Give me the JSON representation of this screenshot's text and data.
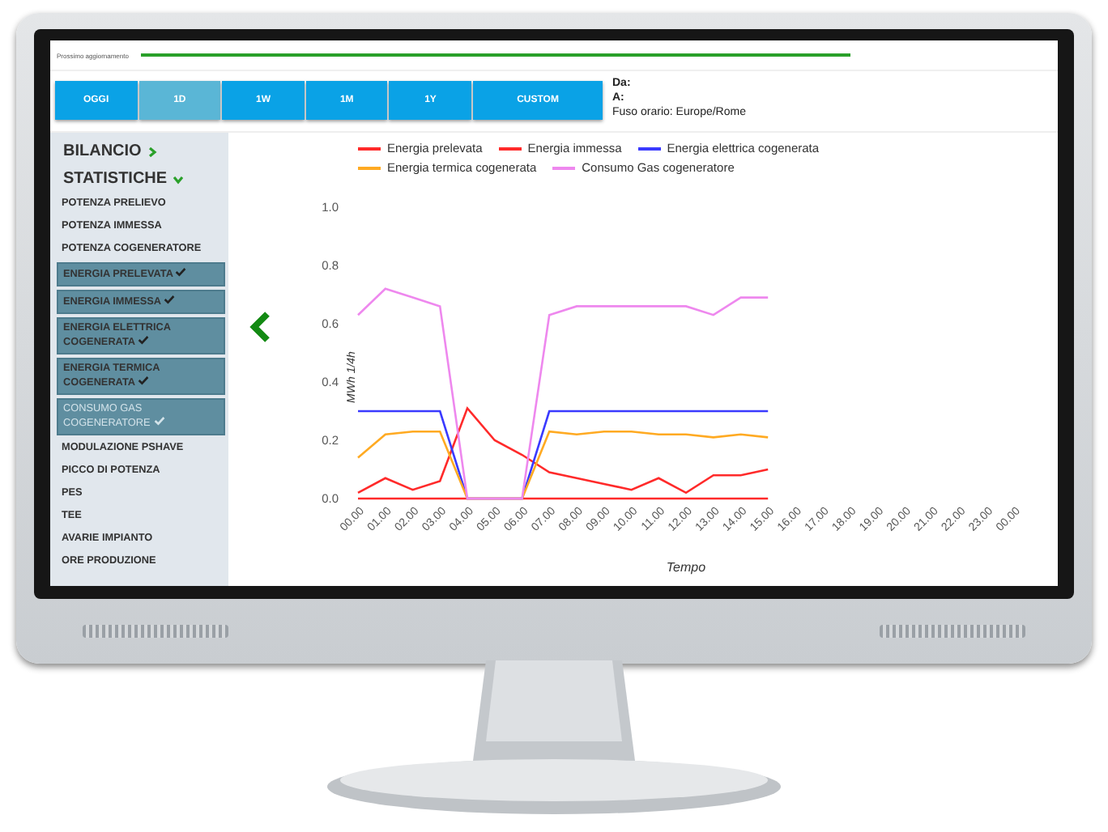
{
  "update_bar": {
    "label": "Prossimo aggiornamento",
    "level": 0.78
  },
  "tabs": [
    {
      "label": "OGGI",
      "selected": false
    },
    {
      "label": "1D",
      "selected": true
    },
    {
      "label": "1W",
      "selected": false
    },
    {
      "label": "1M",
      "selected": false
    },
    {
      "label": "1Y",
      "selected": false
    },
    {
      "label": "CUSTOM",
      "selected": false
    }
  ],
  "range_info": [
    "Da:",
    "A:",
    "Fuso orario: Europe/Rome"
  ],
  "sidebar": {
    "sections": [
      {
        "label": "BILANCIO",
        "expanded": false
      },
      {
        "label": "STATISTICHE",
        "expanded": true,
        "items": [
          {
            "label": "POTENZA PRELIEVO",
            "checked": false,
            "disabled": false
          },
          {
            "label": "POTENZA IMMESSA",
            "checked": false,
            "disabled": false
          },
          {
            "label": "POTENZA COGENERATORE",
            "checked": false,
            "disabled": false
          },
          {
            "label": "ENERGIA PRELEVATA",
            "checked": true,
            "disabled": false
          },
          {
            "label": "ENERGIA IMMESSA",
            "checked": true,
            "disabled": false
          },
          {
            "label": "ENERGIA ELETTRICA COGENERATA",
            "checked": true,
            "disabled": false
          },
          {
            "label": "ENERGIA TERMICA COGENERATA",
            "checked": true,
            "disabled": false
          },
          {
            "label": "CONSUMO GAS COGENERATORE",
            "checked": true,
            "disabled": true
          },
          {
            "label": "MODULAZIONE PSHAVE",
            "checked": false,
            "disabled": false
          },
          {
            "label": "PICCO DI POTENZA",
            "checked": false,
            "disabled": false
          },
          {
            "label": "PES",
            "checked": false,
            "disabled": false
          },
          {
            "label": "TEE",
            "checked": false,
            "disabled": false
          },
          {
            "label": "AVARIE IMPIANTO",
            "checked": false,
            "disabled": false
          },
          {
            "label": "ORE PRODUZIONE",
            "checked": false,
            "disabled": false
          }
        ]
      }
    ]
  },
  "chart": {
    "chart_data": {
      "type": "line",
      "xlabel": "Tempo",
      "ylabel": "MWh 1/4h",
      "categories": [
        "00.00",
        "01.00",
        "02.00",
        "03.00",
        "04.00",
        "05.00",
        "06.00",
        "07.00",
        "08.00",
        "09.00",
        "10.00",
        "11.00",
        "12.00",
        "13.00",
        "14.00",
        "15.00",
        "16.00",
        "17.00",
        "18.00",
        "19.00",
        "20.00",
        "21.00",
        "22.00",
        "23.00",
        "00.00"
      ],
      "ylim": [
        0,
        1
      ],
      "yticks": [
        {
          "value": 0,
          "label": "0.0"
        },
        {
          "value": 0.2,
          "label": "0.2"
        },
        {
          "value": 0.4,
          "label": "0.4"
        },
        {
          "value": 0.6,
          "label": "0.6"
        },
        {
          "value": 0.8,
          "label": "0.8"
        },
        {
          "value": 1,
          "label": "1.0"
        }
      ],
      "series": [
        {
          "name": "Energia prelevata",
          "color": "#ff2a2a",
          "values": [
            0.02,
            0.07,
            0.03,
            0.06,
            0.31,
            0.2,
            0.15,
            0.09,
            0.07,
            0.05,
            0.03,
            0.07,
            0.02,
            0.08,
            0.08,
            0.1,
            null,
            null,
            null,
            null,
            null,
            null,
            null,
            null,
            null
          ]
        },
        {
          "name": "Energia immessa",
          "color": "#ff2a2a",
          "values": [
            0,
            0,
            0,
            0,
            0,
            0,
            0,
            0,
            0,
            0,
            0,
            0,
            0,
            0,
            0,
            0,
            null,
            null,
            null,
            null,
            null,
            null,
            null,
            null,
            null
          ]
        },
        {
          "name": "Energia elettrica cogenerata",
          "color": "#3a3aff",
          "values": [
            0.3,
            0.3,
            0.3,
            0.3,
            0,
            0,
            0,
            0.3,
            0.3,
            0.3,
            0.3,
            0.3,
            0.3,
            0.3,
            0.3,
            0.3,
            null,
            null,
            null,
            null,
            null,
            null,
            null,
            null,
            null
          ]
        },
        {
          "name": "Energia termica cogenerata",
          "color": "#ffaa22",
          "values": [
            0.14,
            0.22,
            0.23,
            0.23,
            0,
            0,
            0,
            0.23,
            0.22,
            0.23,
            0.23,
            0.22,
            0.22,
            0.21,
            0.22,
            0.21,
            null,
            null,
            null,
            null,
            null,
            null,
            null,
            null,
            null
          ]
        },
        {
          "name": "Consumo Gas cogeneratore",
          "color": "#ee88ee",
          "values": [
            0.63,
            0.72,
            0.69,
            0.66,
            0,
            0,
            0,
            0.63,
            0.66,
            0.66,
            0.66,
            0.66,
            0.66,
            0.63,
            0.69,
            0.69,
            null,
            null,
            null,
            null,
            null,
            null,
            null,
            null,
            null
          ]
        }
      ]
    }
  }
}
